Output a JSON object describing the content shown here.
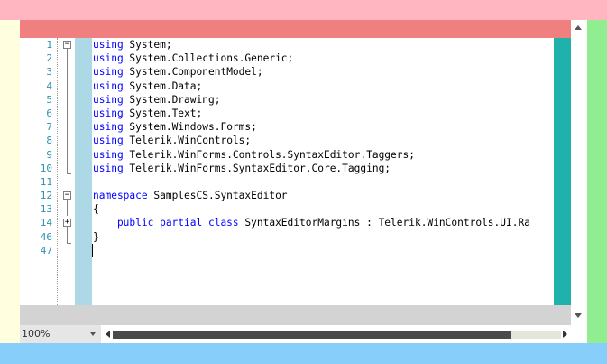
{
  "colors": {
    "top_margin": "#ffb6c1",
    "left_margin": "#ffffe0",
    "right_margin": "#90ee90",
    "bottom_margin": "#87cefa",
    "editor_top_band": "#f08080",
    "right_teal_margin": "#20b2aa",
    "blue_gutter": "#add8e6",
    "keyword": "#0000ff",
    "line_number": "#2b91af"
  },
  "editor": {
    "lines": [
      {
        "number": "1",
        "keyword": "using",
        "text": " System;"
      },
      {
        "number": "2",
        "keyword": "using",
        "text": " System.Collections.Generic;"
      },
      {
        "number": "3",
        "keyword": "using",
        "text": " System.ComponentModel;"
      },
      {
        "number": "4",
        "keyword": "using",
        "text": " System.Data;"
      },
      {
        "number": "5",
        "keyword": "using",
        "text": " System.Drawing;"
      },
      {
        "number": "6",
        "keyword": "using",
        "text": " System.Text;"
      },
      {
        "number": "7",
        "keyword": "using",
        "text": " System.Windows.Forms;"
      },
      {
        "number": "8",
        "keyword": "using",
        "text": " Telerik.WinControls;"
      },
      {
        "number": "9",
        "keyword": "using",
        "text": " Telerik.WinForms.Controls.SyntaxEditor.Taggers;"
      },
      {
        "number": "10",
        "keyword": "using",
        "text": " Telerik.WinForms.SyntaxEditor.Core.Tagging;"
      },
      {
        "number": "11",
        "keyword": "",
        "text": ""
      },
      {
        "number": "12",
        "keyword": "namespace",
        "text": " SamplesCS.SyntaxEditor"
      },
      {
        "number": "13",
        "keyword": "",
        "text": "{"
      },
      {
        "number": "14",
        "keyword": "    public partial class",
        "text": " SyntaxEditorMargins : Telerik.WinControls.UI.Ra"
      },
      {
        "number": "46",
        "keyword": "",
        "text": "}"
      },
      {
        "number": "47",
        "keyword": "",
        "text": ""
      }
    ]
  },
  "fold_markers": {
    "collapse": "−",
    "expand": "+"
  },
  "status": {
    "zoom": "100%"
  },
  "icons": {
    "zoom_dropdown": "chevron-down-icon",
    "scroll_left": "arrow-left-icon",
    "scroll_right": "arrow-right-icon",
    "scroll_up": "arrow-up-icon",
    "scroll_down": "arrow-down-icon"
  }
}
